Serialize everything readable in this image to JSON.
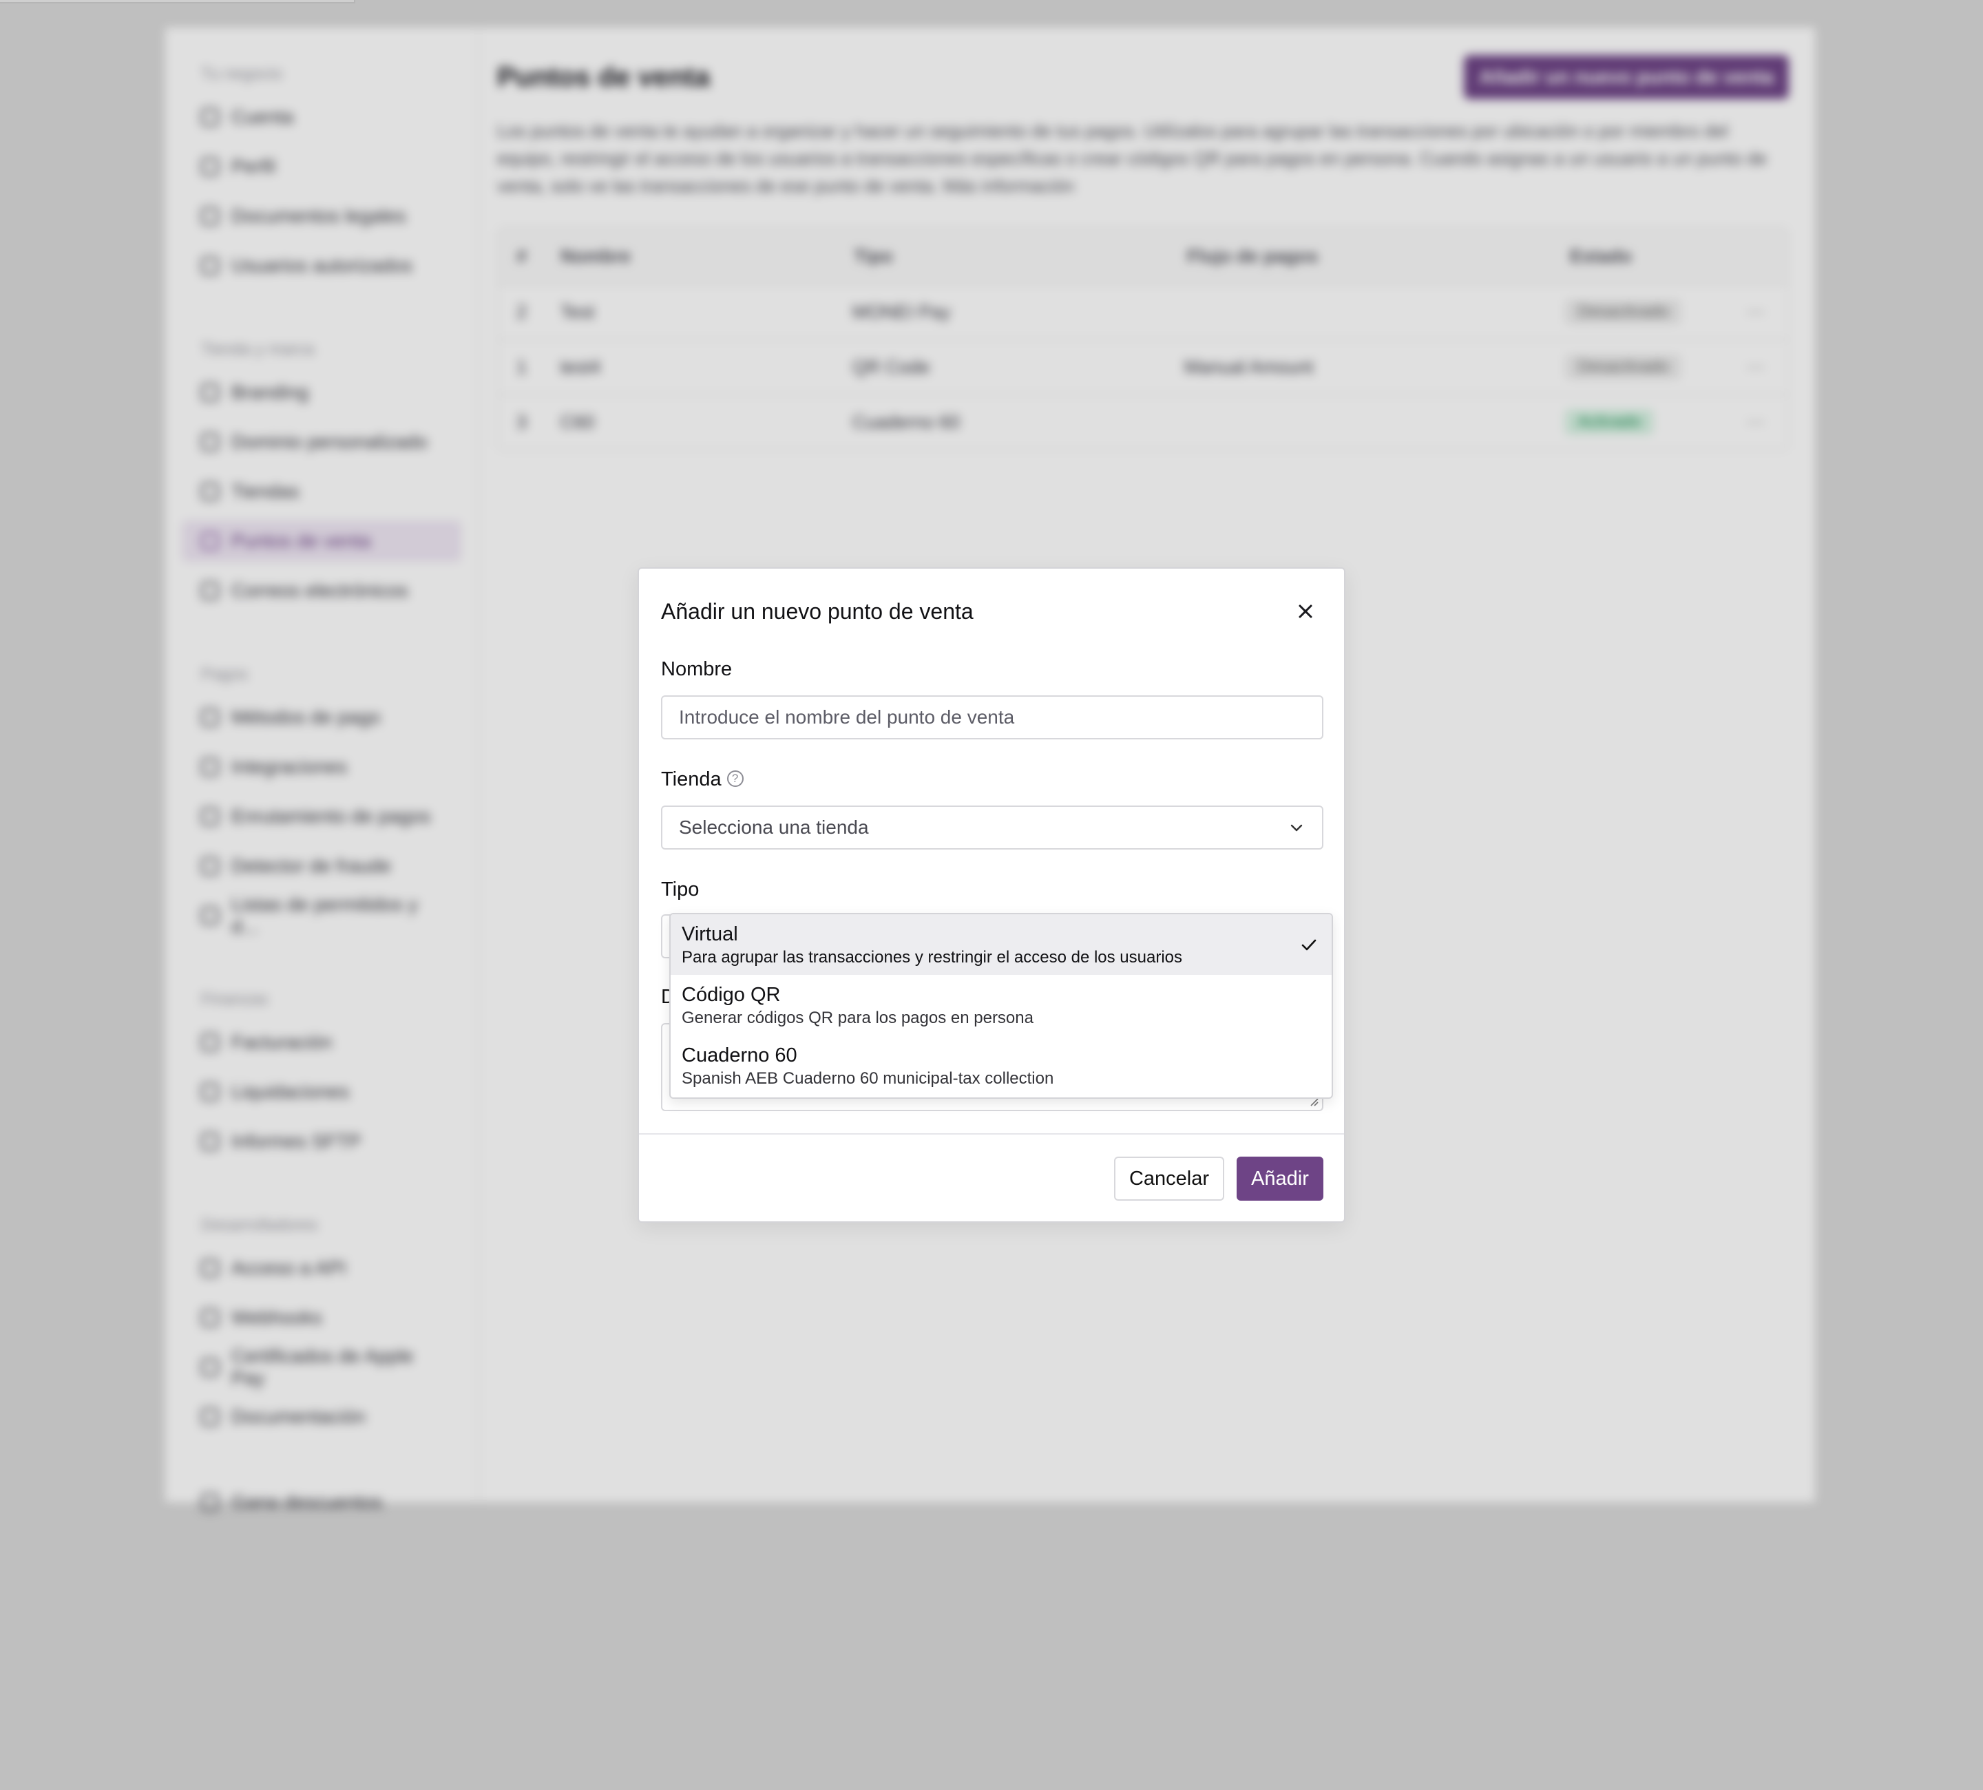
{
  "background": {
    "sidebar": {
      "sections": [
        {
          "title": "Tu negocio",
          "items": [
            "Cuenta",
            "Perfil",
            "Documentos legales",
            "Usuarios autorizados"
          ]
        },
        {
          "title": "Tienda y marca",
          "items": [
            "Branding",
            "Dominio personalizado",
            "Tiendas",
            "Puntos de venta",
            "Correos electrónicos"
          ]
        },
        {
          "title": "Pagos",
          "items": [
            "Métodos de pago",
            "Integraciones",
            "Enrutamiento de pagos",
            "Detector de fraude",
            "Listas de permitidos y d..."
          ]
        },
        {
          "title": "Finanzas",
          "items": [
            "Facturación",
            "Liquidaciones",
            "Informes SFTP"
          ]
        },
        {
          "title": "Desarrolladores",
          "items": [
            "Acceso a API",
            "Webhooks",
            "Certificados de Apple Pay",
            "Documentación"
          ]
        }
      ],
      "active_item": "Puntos de venta",
      "footer_item": "Gana descuentos"
    },
    "main": {
      "title": "Puntos de venta",
      "primary_button": "Añadir un nuevo punto de venta",
      "description": "Los puntos de venta te ayudan a organizar y hacer un seguimiento de tus pagos. Utilízalos para agrupar las transacciones por ubicación o por miembro del equipo, restringir el acceso de los usuarios a transacciones específicas o crear códigos QR para pagos en persona. Cuando asignas a un usuario a un punto de venta, solo ve las transacciones de ese punto de venta. Más información",
      "table": {
        "columns": [
          "#",
          "Nombre",
          "Tipo",
          "Flujo de pagos",
          "Estado"
        ],
        "rows": [
          {
            "idx": "2",
            "name": "Test",
            "type": "MONEI Pay",
            "flow": "",
            "state": "Desactivado",
            "active": false
          },
          {
            "idx": "1",
            "name": "test4",
            "type": "QR Code",
            "flow": "Manual Amount",
            "state": "Desactivado",
            "active": false
          },
          {
            "idx": "3",
            "name": "C60",
            "type": "Cuaderno 60",
            "flow": "",
            "state": "Activado",
            "active": true
          }
        ]
      }
    }
  },
  "modal": {
    "title": "Añadir un nuevo punto de venta",
    "name_label": "Nombre",
    "name_placeholder": "Introduce el nombre del punto de venta",
    "store_label": "Tienda",
    "store_placeholder": "Selecciona una tienda",
    "type_label": "Tipo",
    "hidden_label_initial": "D",
    "cancel_label": "Cancelar",
    "add_label": "Añadir"
  },
  "type_dropdown": {
    "options": [
      {
        "title": "Virtual",
        "subtitle": "Para agrupar las transacciones y restringir el acceso de los usuarios",
        "selected": true
      },
      {
        "title": "Código QR",
        "subtitle": "Generar códigos QR para los pagos en persona",
        "selected": false
      },
      {
        "title": "Cuaderno 60",
        "subtitle": "Spanish AEB Cuaderno 60 municipal-tax collection",
        "selected": false
      }
    ]
  },
  "colors": {
    "accent": "#6e4486",
    "backdrop": "#dadada",
    "selected_option_bg": "#ededf0"
  },
  "icons": [
    "close-icon",
    "help-icon",
    "chevron-down-icon",
    "checkmark-icon"
  ]
}
